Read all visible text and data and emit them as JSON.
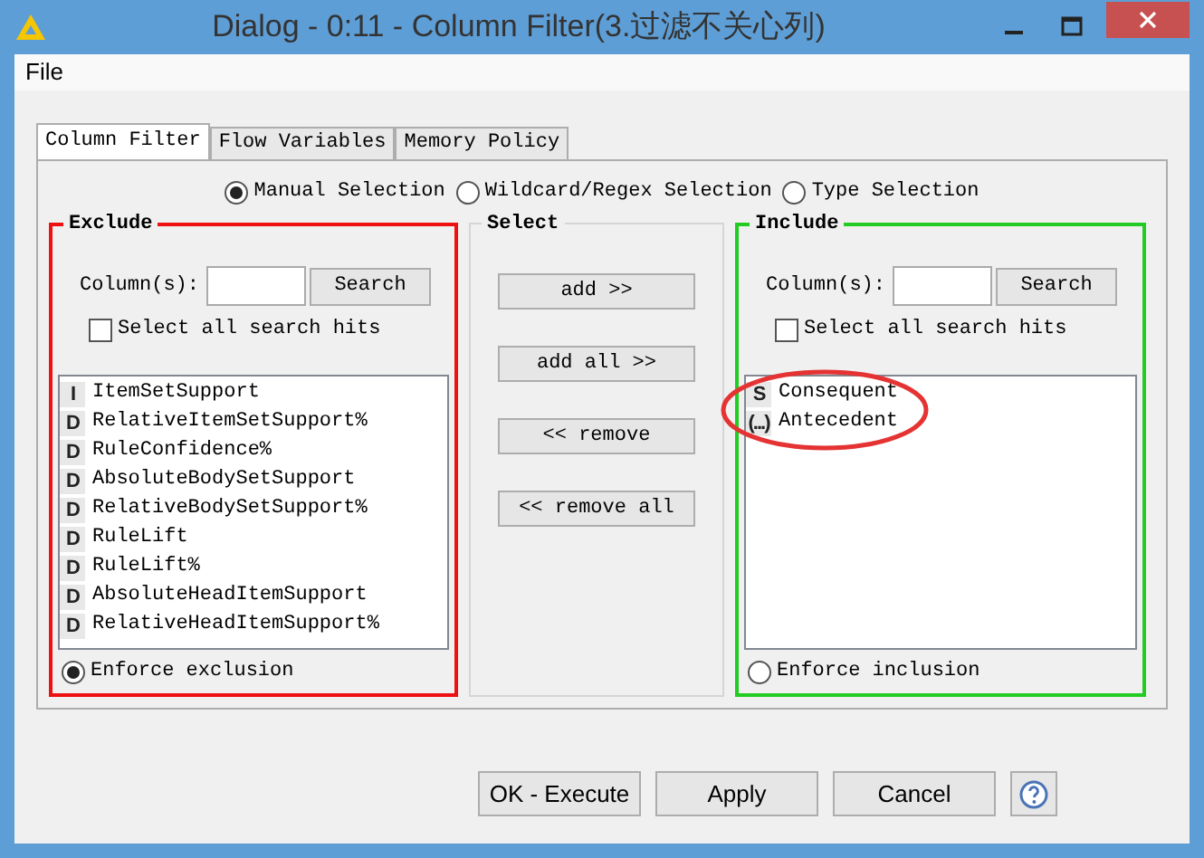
{
  "window": {
    "title": "Dialog - 0:11 - Column Filter(3.过滤不关心列)"
  },
  "menu": [
    "File"
  ],
  "tabs": [
    {
      "label": "Column Filter",
      "selected": true
    },
    {
      "label": "Flow Variables",
      "selected": false
    },
    {
      "label": "Memory Policy",
      "selected": false
    }
  ],
  "modes": [
    {
      "label": "Manual Selection",
      "selected": true
    },
    {
      "label": "Wildcard/Regex Selection",
      "selected": false
    },
    {
      "label": "Type Selection",
      "selected": false
    }
  ],
  "exclude": {
    "title": "Exclude",
    "search_label": "Column(s):",
    "search_button": "Search",
    "select_all": {
      "label": "Select all search hits",
      "checked": false
    },
    "columns": [
      {
        "icon": "I",
        "name": "ItemSetSupport"
      },
      {
        "icon": "D",
        "name": "RelativeItemSetSupport%"
      },
      {
        "icon": "D",
        "name": "RuleConfidence%"
      },
      {
        "icon": "D",
        "name": "AbsoluteBodySetSupport"
      },
      {
        "icon": "D",
        "name": "RelativeBodySetSupport%"
      },
      {
        "icon": "D",
        "name": "RuleLift"
      },
      {
        "icon": "D",
        "name": "RuleLift%"
      },
      {
        "icon": "D",
        "name": "AbsoluteHeadItemSupport"
      },
      {
        "icon": "D",
        "name": "RelativeHeadItemSupport%"
      }
    ],
    "enforce": {
      "label": "Enforce exclusion",
      "selected": true
    }
  },
  "select": {
    "title": "Select",
    "buttons": [
      "add >>",
      "add all >>",
      "<< remove",
      "<< remove all"
    ]
  },
  "include": {
    "title": "Include",
    "search_label": "Column(s):",
    "search_button": "Search",
    "select_all": {
      "label": "Select all search hits",
      "checked": false
    },
    "columns": [
      {
        "icon": "S",
        "name": "Consequent"
      },
      {
        "icon": "(...)",
        "name": "Antecedent"
      }
    ],
    "enforce": {
      "label": "Enforce inclusion",
      "selected": false
    }
  },
  "buttons": [
    "OK - Execute",
    "Apply",
    "Cancel"
  ]
}
